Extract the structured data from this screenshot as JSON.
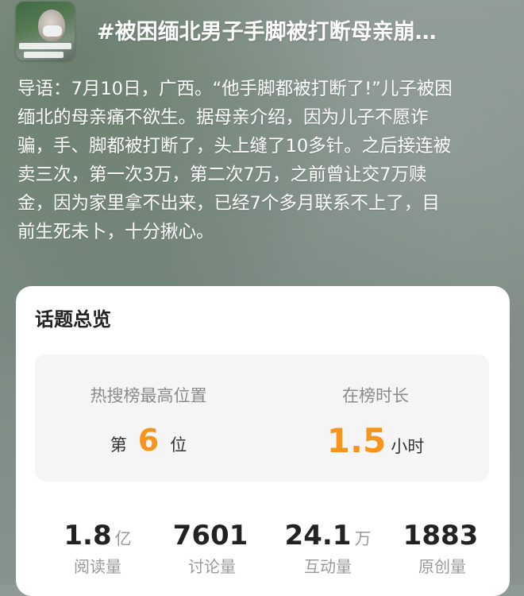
{
  "header": {
    "title": "#被困缅北男子手脚被打断母亲崩…"
  },
  "intro": {
    "lines": [
      "导语：7月10日，广西。“他手脚都被打断了!”儿子被困",
      "缅北的母亲痛不欲生。据母亲介绍，因为儿子不愿诈",
      "骗，手、脚都被打断了，头上缝了10多针。之后接连被",
      "卖三次，第一次3万，第二次7万，之前曾让交7万赎",
      "金，因为家里拿不出来，已经7个多月联系不上了，目",
      "前生死未卜，十分揪心。"
    ]
  },
  "overview": {
    "title": "话题总览",
    "rank": {
      "label": "热搜榜最高位置",
      "prefix": "第",
      "value": "6",
      "suffix": "位"
    },
    "duration": {
      "label": "在榜时长",
      "value": "1.5",
      "unit": "小时"
    },
    "metrics": [
      {
        "value": "1.8",
        "unit": "亿",
        "label": "阅读量"
      },
      {
        "value": "7601",
        "unit": "",
        "label": "讨论量"
      },
      {
        "value": "24.1",
        "unit": "万",
        "label": "互动量"
      },
      {
        "value": "1883",
        "unit": "",
        "label": "原创量"
      }
    ]
  },
  "colors": {
    "accent": "#f7941d",
    "card": "#ffffff",
    "stat_bg": "#f5f5f5"
  }
}
